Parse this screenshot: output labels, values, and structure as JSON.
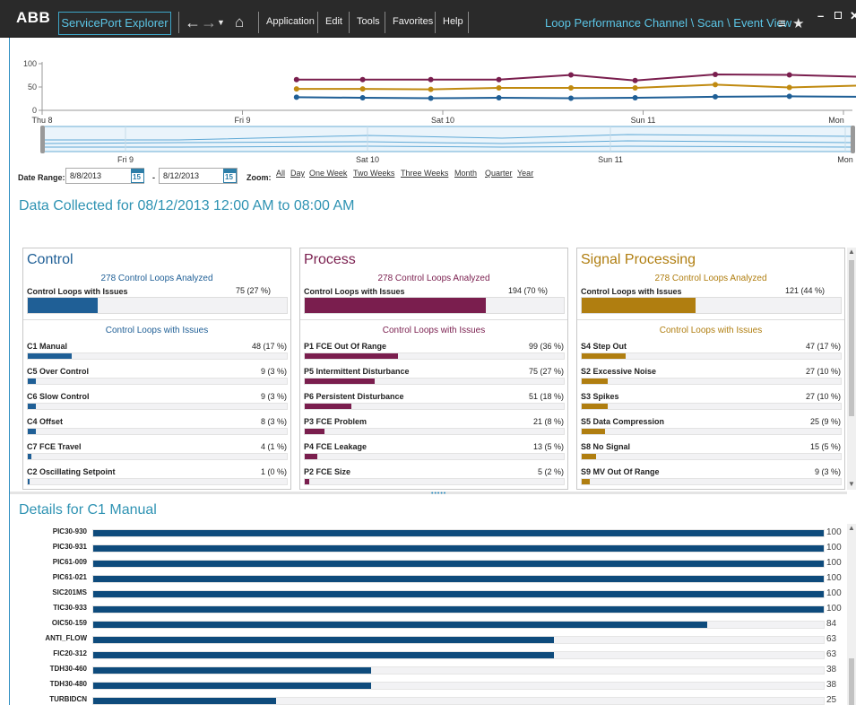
{
  "header": {
    "logo": "ABB",
    "app_title": "ServicePort Explorer",
    "menu": [
      "Application",
      "Edit",
      "Tools",
      "Favorites",
      "Help"
    ],
    "breadcrumb": "Loop Performance Channel \\ Scan \\ Event View",
    "icons": [
      "back-arrow-icon",
      "forward-arrow-icon",
      "dropdown-caret-icon",
      "home-icon",
      "hamburger-menu-icon",
      "star-icon",
      "minimize-icon",
      "maximize-icon",
      "close-icon"
    ]
  },
  "trend_chart": {
    "y_ticks": [
      "100",
      "50",
      "0"
    ],
    "x_ticks": [
      "Thu 8",
      "Fri 9",
      "Sat 10",
      "Sun 11",
      "Mon"
    ],
    "navigator_ticks": [
      "Fri 9",
      "Sat 10",
      "Sun 11",
      "Mon"
    ],
    "colors": {
      "control": "#1f5f96",
      "process": "#7a1e4e",
      "signal": "#c08a10"
    }
  },
  "chart_data": {
    "type": "line",
    "x": [
      "Thu 8",
      "Fri 9",
      "Sat 10",
      "Sun 11",
      "Mon"
    ],
    "ylim": [
      0,
      100
    ],
    "series": [
      {
        "values": [
          66,
          66,
          66,
          66,
          76,
          64,
          77,
          76,
          72,
          70,
          71
        ]
      },
      {
        "values": [
          46,
          46,
          45,
          48,
          48,
          48,
          55,
          49,
          53,
          49,
          45
        ]
      },
      {
        "values": [
          28,
          27,
          26,
          27,
          26,
          27,
          29,
          30,
          29,
          28,
          28
        ]
      }
    ],
    "sample_times": [
      1.27,
      1.6,
      1.94,
      2.28,
      2.64,
      2.96,
      3.36,
      3.73,
      4.08,
      4.45,
      4.79
    ]
  },
  "date_range": {
    "label": "Date Range:",
    "from": "8/8/2013",
    "separator": "-",
    "to": "8/12/2013",
    "calendar_day": "15",
    "zoom_label": "Zoom:",
    "zoom_options": [
      "All",
      "Day",
      "One Week",
      "Two Weeks",
      "Three Weeks",
      "Month",
      "Quarter",
      "Year"
    ]
  },
  "data_collected_title": "Data Collected for 08/12/2013 12:00 AM to 08:00 AM",
  "panels": [
    {
      "title": "Control",
      "color": "#1f5f96",
      "analyzed": "278 Control Loops Analyzed",
      "issues_label": "Control Loops with Issues",
      "issues_value": "75 (27 %)",
      "issues_fraction": 0.27,
      "subtitle": "Control Loops with Issues",
      "rows": [
        {
          "label": "C1 Manual",
          "value": "48 (17 %)",
          "fraction": 0.17
        },
        {
          "label": "C5 Over Control",
          "value": "9 (3 %)",
          "fraction": 0.03
        },
        {
          "label": "C6 Slow Control",
          "value": "9 (3 %)",
          "fraction": 0.03
        },
        {
          "label": "C4 Offset",
          "value": "8 (3 %)",
          "fraction": 0.03
        },
        {
          "label": "C7 FCE Travel",
          "value": "4 (1 %)",
          "fraction": 0.015
        },
        {
          "label": "C2 Oscillating Setpoint",
          "value": "1 (0 %)",
          "fraction": 0.004
        }
      ]
    },
    {
      "title": "Process",
      "color": "#7a1e4e",
      "analyzed": "278 Control Loops Analyzed",
      "issues_label": "Control Loops with Issues",
      "issues_value": "194 (70 %)",
      "issues_fraction": 0.7,
      "subtitle": "Control Loops with Issues",
      "rows": [
        {
          "label": "P1 FCE Out Of Range",
          "value": "99 (36 %)",
          "fraction": 0.36
        },
        {
          "label": "P5 Intermittent Disturbance",
          "value": "75 (27 %)",
          "fraction": 0.27
        },
        {
          "label": "P6 Persistent Disturbance",
          "value": "51 (18 %)",
          "fraction": 0.18
        },
        {
          "label": "P3 FCE Problem",
          "value": "21 (8 %)",
          "fraction": 0.075
        },
        {
          "label": "P4 FCE Leakage",
          "value": "13 (5 %)",
          "fraction": 0.047
        },
        {
          "label": "P2 FCE Size",
          "value": "5 (2 %)",
          "fraction": 0.018
        }
      ]
    },
    {
      "title": "Signal Processing",
      "color": "#b07e10",
      "analyzed": "278 Control Loops Analyzed",
      "issues_label": "Control Loops with Issues",
      "issues_value": "121 (44 %)",
      "issues_fraction": 0.44,
      "subtitle": "Control Loops with Issues",
      "rows": [
        {
          "label": "S4 Step Out",
          "value": "47 (17 %)",
          "fraction": 0.17
        },
        {
          "label": "S2 Excessive Noise",
          "value": "27 (10 %)",
          "fraction": 0.1
        },
        {
          "label": "S3 Spikes",
          "value": "27 (10 %)",
          "fraction": 0.1
        },
        {
          "label": "S5 Data Compression",
          "value": "25 (9 %)",
          "fraction": 0.09
        },
        {
          "label": "S8 No Signal",
          "value": "15 (5 %)",
          "fraction": 0.054
        },
        {
          "label": "S9 MV Out Of Range",
          "value": "9 (3 %)",
          "fraction": 0.032
        }
      ]
    }
  ],
  "details": {
    "title": "Details for C1 Manual",
    "rows": [
      {
        "tag": "PIC30-930",
        "value": "100"
      },
      {
        "tag": "PIC30-931",
        "value": "100"
      },
      {
        "tag": "PIC61-009",
        "value": "100"
      },
      {
        "tag": "PIC61-021",
        "value": "100"
      },
      {
        "tag": "SIC201MS",
        "value": "100"
      },
      {
        "tag": "TIC30-933",
        "value": "100"
      },
      {
        "tag": "OIC50-159",
        "value": "84"
      },
      {
        "tag": "ANTI_FLOW",
        "value": "63"
      },
      {
        "tag": "FIC20-312",
        "value": "63"
      },
      {
        "tag": "TDH30-460",
        "value": "38"
      },
      {
        "tag": "TDH30-480",
        "value": "38"
      },
      {
        "tag": "TURBIDCN",
        "value": "25"
      }
    ]
  }
}
